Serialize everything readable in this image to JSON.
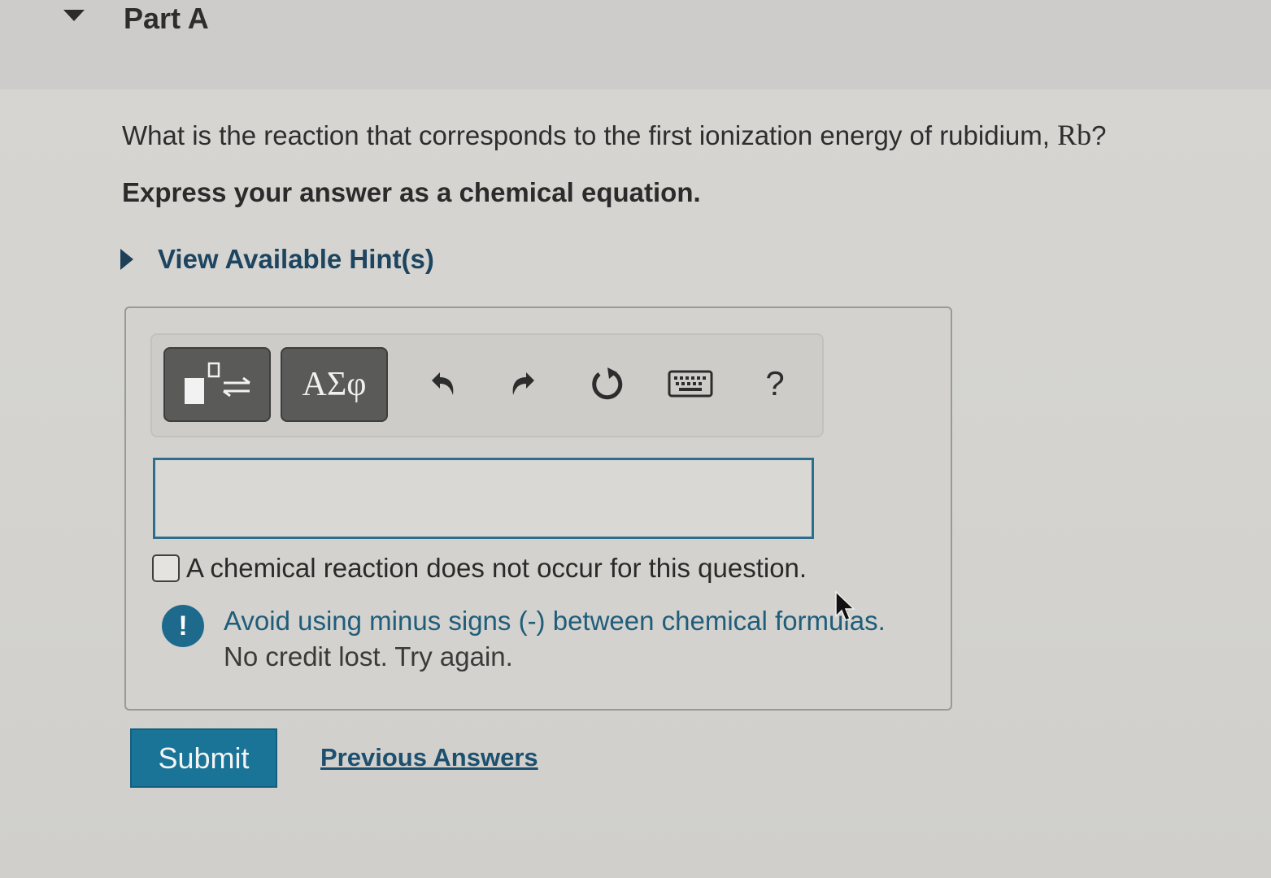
{
  "part": {
    "title": "Part A"
  },
  "question": {
    "text": "What is the reaction that corresponds to the first ionization energy of rubidium, ",
    "symbol": "Rb",
    "suffix": "?",
    "instruction": "Express your answer as a chemical equation."
  },
  "hint": {
    "label": "View Available Hint(s)"
  },
  "toolbar": {
    "symbols_label": "ΑΣφ",
    "help_label": "?",
    "icons": [
      "templates-icon",
      "undo-icon",
      "redo-icon",
      "reset-icon",
      "keyboard-icon",
      "help-icon"
    ]
  },
  "answer": {
    "value": ""
  },
  "no_reaction": {
    "label": "A chemical reaction does not occur for this question.",
    "checked": false
  },
  "feedback": {
    "icon": "!",
    "line1": "Avoid using minus signs (-) between chemical formulas.",
    "line2": "No credit lost. Try again."
  },
  "actions": {
    "submit_label": "Submit",
    "previous_answers_label": "Previous Answers"
  },
  "colors": {
    "accent": "#1a7497",
    "link": "#1d4f6f",
    "feedback": "#1e6a8c"
  }
}
